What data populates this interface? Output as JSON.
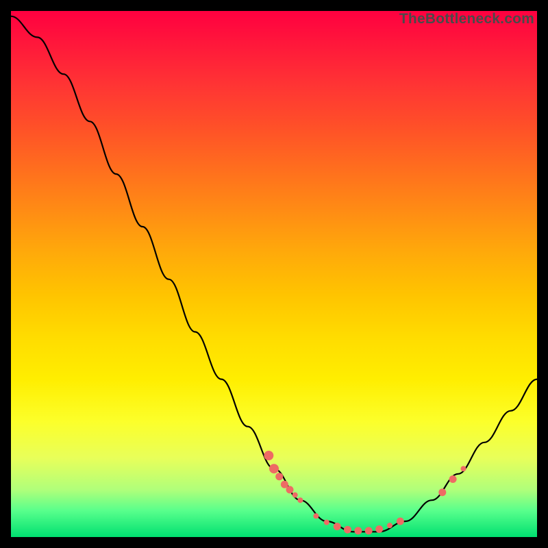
{
  "watermark": "TheBottleneck.com",
  "chart_data": {
    "type": "line",
    "title": "",
    "xlabel": "",
    "ylabel": "",
    "xlim": [
      0,
      100
    ],
    "ylim": [
      0,
      100
    ],
    "grid": false,
    "legend": false,
    "curve_points": [
      {
        "x": 0,
        "y": 99
      },
      {
        "x": 5,
        "y": 95
      },
      {
        "x": 10,
        "y": 88
      },
      {
        "x": 15,
        "y": 79
      },
      {
        "x": 20,
        "y": 69
      },
      {
        "x": 25,
        "y": 59
      },
      {
        "x": 30,
        "y": 49
      },
      {
        "x": 35,
        "y": 39
      },
      {
        "x": 40,
        "y": 30
      },
      {
        "x": 45,
        "y": 21
      },
      {
        "x": 50,
        "y": 13
      },
      {
        "x": 55,
        "y": 7
      },
      {
        "x": 60,
        "y": 3
      },
      {
        "x": 65,
        "y": 1
      },
      {
        "x": 70,
        "y": 1
      },
      {
        "x": 75,
        "y": 3
      },
      {
        "x": 80,
        "y": 7
      },
      {
        "x": 85,
        "y": 12
      },
      {
        "x": 90,
        "y": 18
      },
      {
        "x": 95,
        "y": 24
      },
      {
        "x": 100,
        "y": 30
      }
    ],
    "dots": [
      {
        "x": 49,
        "y": 15.5,
        "size": "lg"
      },
      {
        "x": 50,
        "y": 13.0,
        "size": "lg"
      },
      {
        "x": 51,
        "y": 11.5,
        "size": "md"
      },
      {
        "x": 52,
        "y": 10.0,
        "size": "md"
      },
      {
        "x": 53,
        "y": 9.0,
        "size": "md"
      },
      {
        "x": 54,
        "y": 8.0,
        "size": "sm"
      },
      {
        "x": 55,
        "y": 7.0,
        "size": "sm"
      },
      {
        "x": 58,
        "y": 4.0,
        "size": "sm"
      },
      {
        "x": 60,
        "y": 2.8,
        "size": "sm"
      },
      {
        "x": 62,
        "y": 2.0,
        "size": "md"
      },
      {
        "x": 64,
        "y": 1.4,
        "size": "md"
      },
      {
        "x": 66,
        "y": 1.2,
        "size": "md"
      },
      {
        "x": 68,
        "y": 1.2,
        "size": "md"
      },
      {
        "x": 70,
        "y": 1.5,
        "size": "md"
      },
      {
        "x": 72,
        "y": 2.2,
        "size": "sm"
      },
      {
        "x": 74,
        "y": 3.0,
        "size": "md"
      },
      {
        "x": 82,
        "y": 8.5,
        "size": "md"
      },
      {
        "x": 84,
        "y": 11.0,
        "size": "md"
      },
      {
        "x": 86,
        "y": 13.0,
        "size": "sm"
      }
    ]
  }
}
